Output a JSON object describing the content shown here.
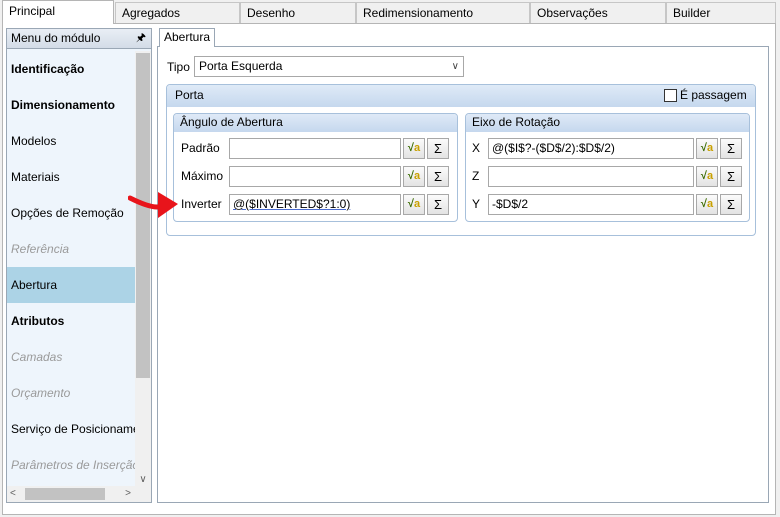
{
  "tabs": [
    "Principal",
    "Agregados",
    "Desenho",
    "Redimensionamento",
    "Observações",
    "Builder"
  ],
  "menu": {
    "title": "Menu do módulo",
    "pin_glyph": "ꟷ",
    "items": [
      {
        "label": "Identificação",
        "style": "bold"
      },
      {
        "label": "Dimensionamento",
        "style": "bold"
      },
      {
        "label": "Modelos",
        "style": "normal"
      },
      {
        "label": "Materiais",
        "style": "normal"
      },
      {
        "label": "Opções de Remoção",
        "style": "normal"
      },
      {
        "label": "Referência",
        "style": "disabled"
      },
      {
        "label": "Abertura",
        "style": "selected"
      },
      {
        "label": "Atributos",
        "style": "bold"
      },
      {
        "label": "Camadas",
        "style": "disabled"
      },
      {
        "label": "Orçamento",
        "style": "disabled"
      },
      {
        "label": "Serviço de Posicionamen",
        "style": "normal"
      },
      {
        "label": "Parâmetros de Inserção",
        "style": "disabled"
      }
    ]
  },
  "subtab": "Abertura",
  "tipo": {
    "label": "Tipo",
    "value": "Porta Esquerda"
  },
  "porta": {
    "title": "Porta",
    "passagem_label": "É passagem",
    "passagem_checked": false
  },
  "angulo": {
    "title": "Ângulo de Abertura",
    "fields": [
      {
        "label": "Padrão",
        "value": ""
      },
      {
        "label": "Máximo",
        "value": ""
      },
      {
        "label": "Inverter",
        "value": "@($INVERTED$?1:0)"
      }
    ]
  },
  "eixo": {
    "title": "Eixo de Rotação",
    "fields": [
      {
        "label": "X",
        "value": "@($I$?-($D$/2):$D$/2)"
      },
      {
        "label": "Z",
        "value": ""
      },
      {
        "label": "Y",
        "value": "-$D$/2"
      }
    ]
  },
  "buttons": {
    "formula_glyph": "√a",
    "sum_glyph": "Σ"
  },
  "colors": {
    "selected_bg": "#acd3e6",
    "arrow": "#e8141b",
    "group_header": "#c5d8ee"
  }
}
